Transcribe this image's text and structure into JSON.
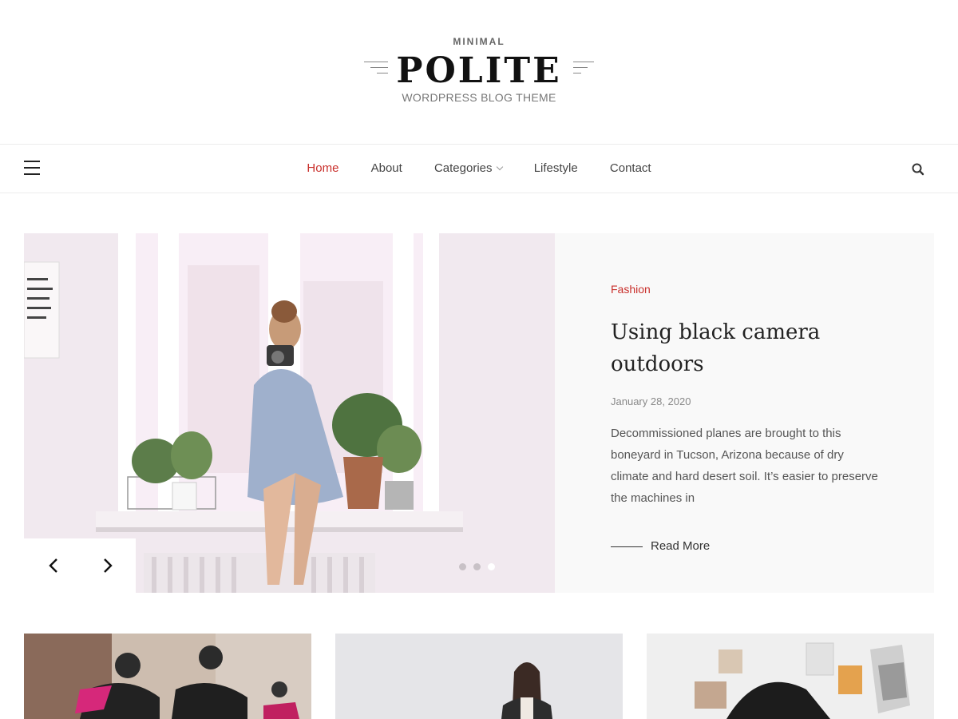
{
  "logo": {
    "tagline_top": "MINIMAL",
    "title": "POLITE",
    "subtitle": "WORDPRESS BLOG THEME"
  },
  "nav": {
    "menu_icon": "hamburger-icon",
    "items": [
      {
        "label": "Home",
        "active": true
      },
      {
        "label": "About",
        "active": false
      },
      {
        "label": "Categories",
        "active": false,
        "has_dropdown": true
      },
      {
        "label": "Lifestyle",
        "active": false
      },
      {
        "label": "Contact",
        "active": false
      }
    ],
    "search_icon": "search-icon"
  },
  "hero": {
    "category": "Fashion",
    "title": "Using black camera outdoors",
    "date": "January 28, 2020",
    "excerpt": "Decommissioned planes are brought to this boneyard in Tucson, Arizona because of dry climate and hard desert soil. It’s easier to preserve the machines in",
    "read_more": "Read More",
    "slider": {
      "prev_icon": "chevron-left-icon",
      "next_icon": "chevron-right-icon",
      "dot_count": 3,
      "active_dot": 3
    }
  },
  "colors": {
    "accent": "#c9302c",
    "text": "#333333",
    "panel_bg": "#f9f9f9"
  }
}
